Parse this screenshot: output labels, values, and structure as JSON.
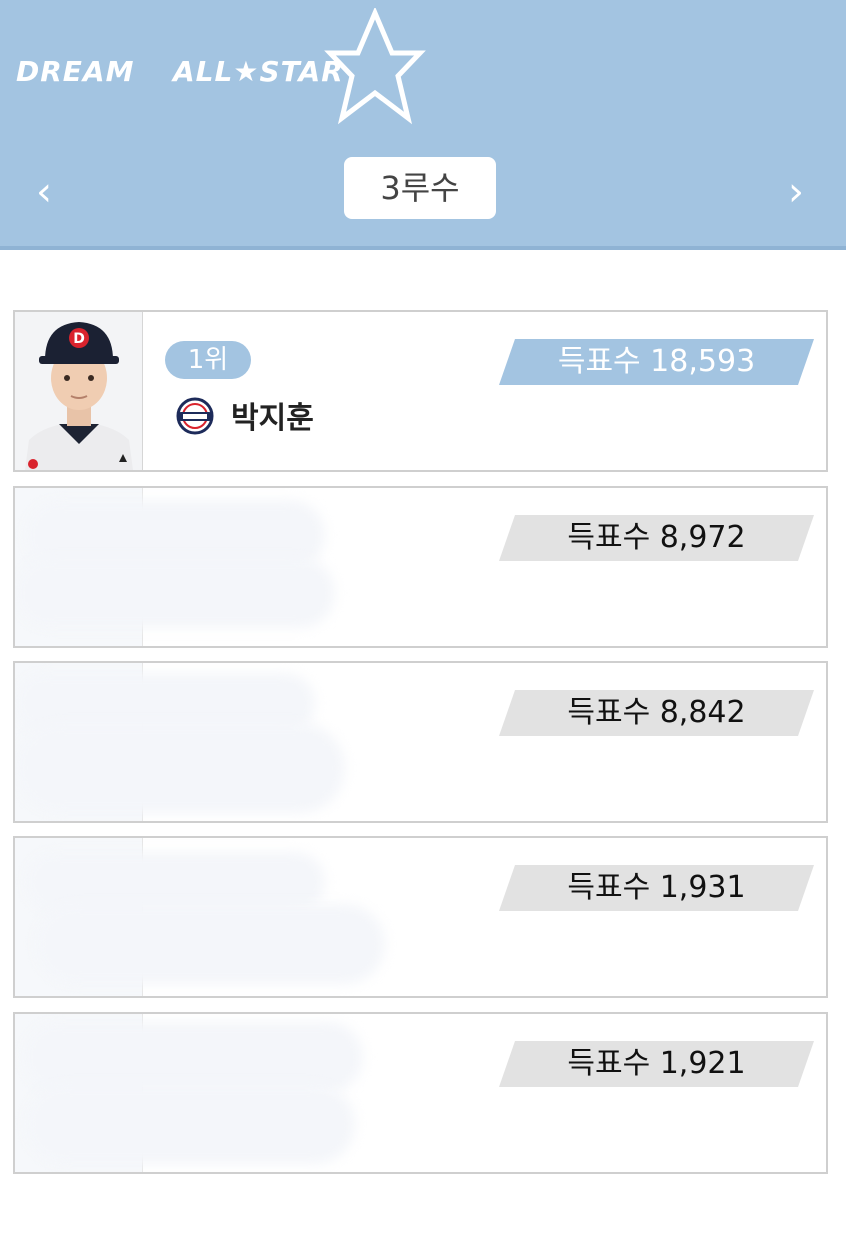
{
  "header": {
    "logo_left": "DREAM",
    "logo_right": "ALL★STAR",
    "position": "3루수",
    "prev_icon": "chevron-left-icon",
    "next_icon": "chevron-right-icon",
    "prev_glyph": "‹",
    "next_glyph": "›",
    "colors": {
      "header_bg": "#a3c4e1",
      "vote_top": "#a3c4e1",
      "vote_other": "#e2e2e2"
    }
  },
  "players": [
    {
      "rank": "1위",
      "name": "박지훈",
      "team_icon": "bears-logo-icon",
      "votes": "득표수 18,593"
    },
    {
      "votes": "득표수 8,972"
    },
    {
      "votes": "득표수 8,842"
    },
    {
      "votes": "득표수 1,931"
    },
    {
      "votes": "득표수 1,921"
    }
  ]
}
